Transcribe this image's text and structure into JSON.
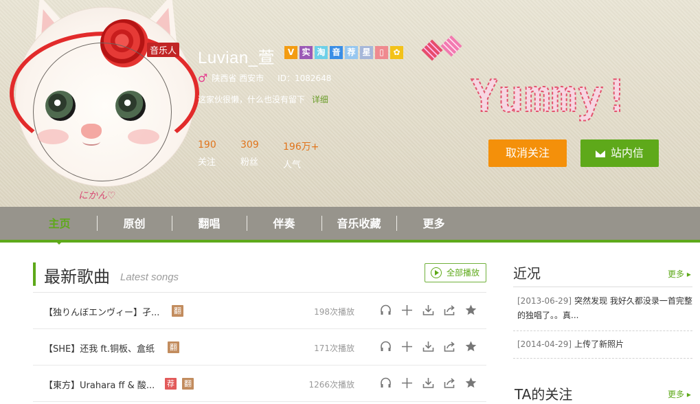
{
  "profile": {
    "role_badge": "音乐人",
    "name": "Luvian_萱",
    "badges": [
      "V",
      "实",
      "淘",
      "音",
      "荐",
      "星",
      "▯",
      "✿"
    ],
    "gender_symbol": "♂",
    "location": "陕西省  西安市",
    "user_id": "ID：1082648",
    "bio": "这家伙很懒，什么也没有留下",
    "bio_more": "详细",
    "signature": "にかん♡",
    "stats": [
      {
        "value": "190",
        "label": "关注"
      },
      {
        "value": "309",
        "label": "粉丝"
      },
      {
        "value": "196万+",
        "label": "人气"
      }
    ],
    "decor_text": "Yummy!"
  },
  "actions": {
    "unfollow_label": "取消关注",
    "message_label": "站内信"
  },
  "nav": {
    "items": [
      "主页",
      "原创",
      "翻唱",
      "伴奏",
      "音乐收藏",
      "更多"
    ]
  },
  "songs_section": {
    "title": "最新歌曲",
    "subtitle": "Latest songs",
    "play_all_label": "全部播放",
    "songs": [
      {
        "title": "【独りんぼエンヴィー】孑...",
        "tags": [
          "翻"
        ],
        "plays": "198次播放"
      },
      {
        "title": "【SHE】还我 ft.铜板、盒纸",
        "tags": [
          "翻"
        ],
        "plays": "171次播放"
      },
      {
        "title": "【東方】Urahara ff & 酸...",
        "tags": [
          "荐",
          "翻"
        ],
        "plays": "1266次播放"
      }
    ]
  },
  "sidebar": {
    "recent_title": "近况",
    "recent_more": "更多 ▸",
    "recent_items": [
      {
        "date": "[2013-06-29]",
        "text": "突然发现 我好久都没录一首完整的独唱了。。真..."
      },
      {
        "date": "[2014-04-29]",
        "text": "上传了新照片"
      }
    ],
    "following_title": "TA的关注",
    "following_more": "更多 ▸"
  },
  "colors": {
    "accent_green": "#5ea91a",
    "accent_orange": "#f4900a",
    "nav_bg": "#97948c"
  }
}
